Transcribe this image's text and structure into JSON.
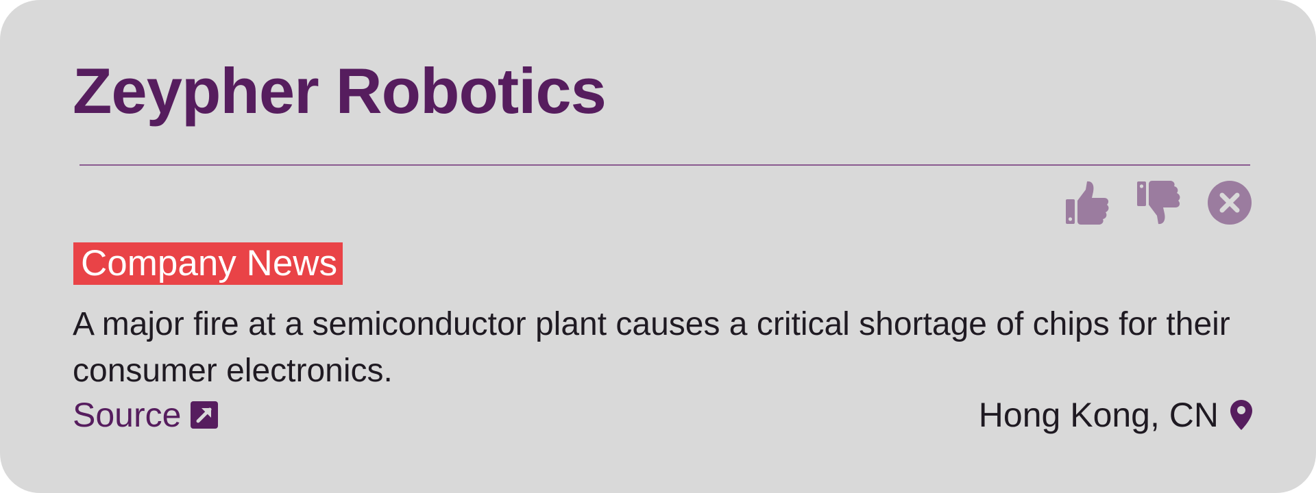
{
  "card": {
    "company_name": "Zeypher Robotics",
    "category_badge": "Company News",
    "summary": "A major fire at a semiconductor plant causes a critical shortage of chips for their consumer electronics.",
    "source_label": "Source",
    "location": "Hong Kong, CN"
  },
  "icons": {
    "like": "thumbs-up-icon",
    "dislike": "thumbs-down-icon",
    "dismiss": "close-circle-icon",
    "external_link": "external-link-icon",
    "location": "map-pin-icon"
  },
  "colors": {
    "card_background": "#d9d9d9",
    "title": "#561d5e",
    "divider": "#8a5a90",
    "action_icons": "#9b7c9f",
    "badge_background": "#e94347",
    "badge_text": "#ffffff",
    "body_text": "#1f1a22",
    "link": "#561d5e"
  }
}
